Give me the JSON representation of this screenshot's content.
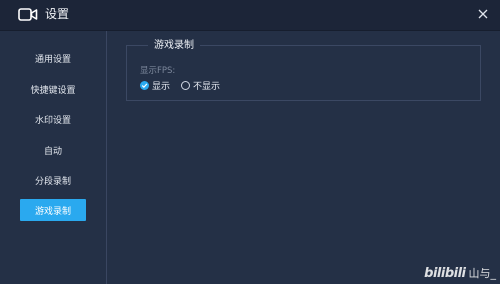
{
  "window": {
    "title": "设置",
    "icons": {
      "app": "video-camera-icon",
      "close": "close-icon"
    }
  },
  "sidebar": {
    "items": [
      {
        "label": "通用设置",
        "active": false
      },
      {
        "label": "快捷键设置",
        "active": false
      },
      {
        "label": "水印设置",
        "active": false
      },
      {
        "label": "自动",
        "active": false
      },
      {
        "label": "分段录制",
        "active": false
      },
      {
        "label": "游戏录制",
        "active": true
      }
    ]
  },
  "game_recording": {
    "section_title": "游戏录制",
    "fps_label": "显示FPS:",
    "options": [
      {
        "label": "显示",
        "selected": true
      },
      {
        "label": "不显示",
        "selected": false
      }
    ]
  },
  "watermark": {
    "logo_text": "bilibili",
    "user_text": "山与_"
  },
  "colors": {
    "accent": "#2aa9ef",
    "background": "#243046",
    "titlebar": "#1c2538"
  }
}
